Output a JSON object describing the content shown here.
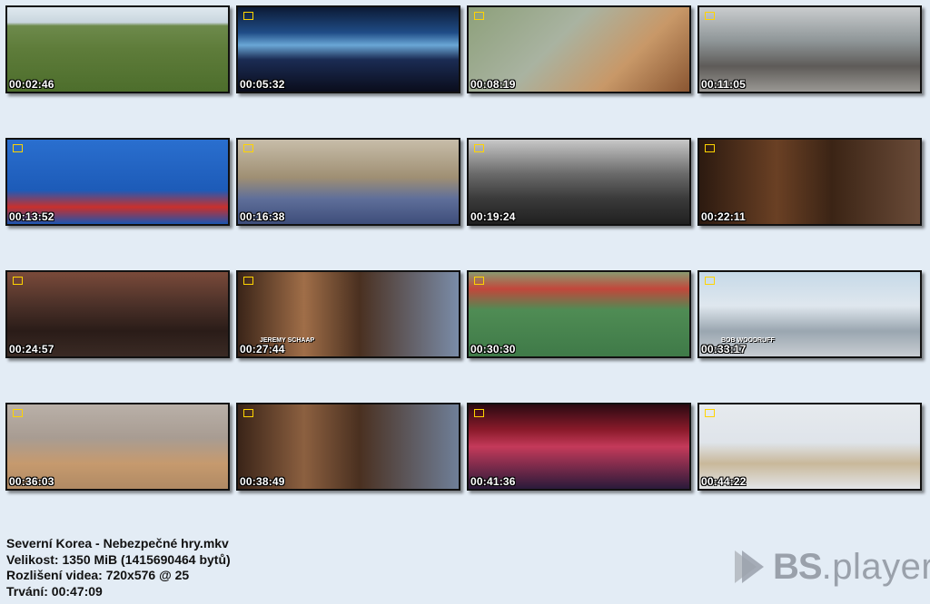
{
  "thumbnails": [
    {
      "time": "00:02:46",
      "bg": "linear-gradient(180deg,#dfe8ef 0%,#c9d6de 18%,#6d8a4b 22%,#5e7c3a 50%,#4d6e2c 100%)"
    },
    {
      "time": "00:05:32",
      "bg": "linear-gradient(180deg,#0c1a35 0%,#1f4c86 30%,#6aa7d6 45%,#1b2c54 62%,#0a0d1c 100%)"
    },
    {
      "time": "00:08:19",
      "bg": "linear-gradient(135deg,#8da07a 0%,#a9b3a1 40%,#c89868 70%,#8a5632 100%)"
    },
    {
      "time": "00:11:05",
      "bg": "linear-gradient(180deg,#c9ccce 0%,#8f9698 40%,#5e5b58 70%,#9a9894 100%)"
    },
    {
      "time": "00:13:52",
      "bg": "linear-gradient(180deg,#2a6fcf 0%,#1d5bb8 60%,#c9302c 80%,#1b55b1 100%)"
    },
    {
      "time": "00:16:38",
      "bg": "linear-gradient(180deg,#c7bda9 0%,#9f8f73 45%,#5f6f9a 70%,#3e4d7a 100%)"
    },
    {
      "time": "00:19:24",
      "bg": "linear-gradient(180deg,#c8c8c8 0%,#6b6b6b 40%,#3a3a3a 70%,#202020 100%)"
    },
    {
      "time": "00:22:11",
      "bg": "linear-gradient(90deg,#2c1a10 0%,#6a4024 35%,#3b2415 60%,#6a4b38 100%)"
    },
    {
      "time": "00:24:57",
      "bg": "linear-gradient(180deg,#7a4a3a 0%,#4a3028 40%,#2a1c18 70%,#3a2a24 100%)"
    },
    {
      "time": "00:27:44",
      "bg": "linear-gradient(90deg,#3a2418 0%,#a06e48 30%,#4a3020 55%,#7a8ca8 100%)",
      "caption": "JEREMY SCHAAP"
    },
    {
      "time": "00:30:30",
      "bg": "linear-gradient(180deg,#8a9a70 0%,#c2473b 20%,#4f8c54 45%,#3f7a48 100%)"
    },
    {
      "time": "00:33:17",
      "bg": "linear-gradient(180deg,#c6d9e8 0%,#dfe7ee 40%,#9aa6b0 70%,#c8cdd2 100%)",
      "caption": "BOB WOODRUFF"
    },
    {
      "time": "00:36:03",
      "bg": "linear-gradient(180deg,#b9b0a8 0%,#a89c92 40%,#c69a6e 70%,#b08a64 100%)"
    },
    {
      "time": "00:38:49",
      "bg": "linear-gradient(90deg,#3a2418 0%,#8c6040 30%,#4a3020 55%,#6f7f98 100%)"
    },
    {
      "time": "00:41:36",
      "bg": "linear-gradient(180deg,#2a0a12 0%,#8a1a2a 30%,#c43a5a 50%,#2a1a3a 100%)"
    },
    {
      "time": "00:44:22",
      "bg": "linear-gradient(180deg,#e6eaee 0%,#dfe4ea 45%,#c9b89a 70%,#e2e5e8 100%)"
    }
  ],
  "file_info": {
    "name": "Severní Korea - Nebezpečné hry.mkv",
    "size": "Velikost: 1350 MiB (1415690464 bytů)",
    "resolution": "Rozlišení videa: 720x576 @ 25",
    "duration": "Trvání: 00:47:09"
  },
  "branding": {
    "bs_text": "BS",
    "player_text": ".player",
    "logo_icon": "bsplayer-logo-icon"
  }
}
